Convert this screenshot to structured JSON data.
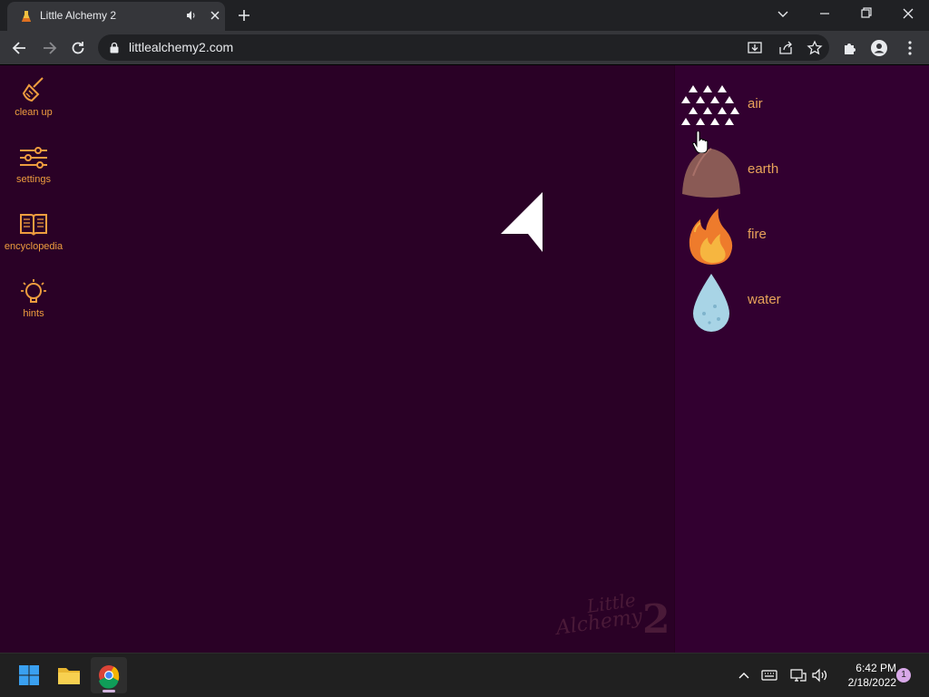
{
  "browser": {
    "tab_title": "Little Alchemy 2",
    "url": "littlealchemy2.com"
  },
  "tools": [
    {
      "label": "clean up",
      "icon": "broom-icon"
    },
    {
      "label": "settings",
      "icon": "sliders-icon"
    },
    {
      "label": "encyclopedia",
      "icon": "book-icon"
    },
    {
      "label": "hints",
      "icon": "lightbulb-icon"
    }
  ],
  "elements": [
    {
      "name": "air",
      "icon": "air-icon"
    },
    {
      "name": "earth",
      "icon": "earth-icon"
    },
    {
      "name": "fire",
      "icon": "fire-icon"
    },
    {
      "name": "water",
      "icon": "water-icon"
    }
  ],
  "watermark": {
    "line1": "Little",
    "line2": "Alchemy",
    "number": "2"
  },
  "taskbar": {
    "time": "6:42 PM",
    "date": "2/18/2022",
    "notification_count": "1"
  },
  "colors": {
    "workspace_bg": "#2a0126",
    "sidebar_bg": "#320030",
    "accent": "#ee9d3f",
    "element_text": "#e8a35a"
  }
}
